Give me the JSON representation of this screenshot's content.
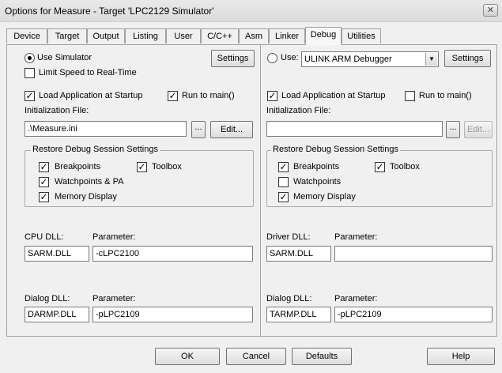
{
  "window": {
    "title": "Options for Measure - Target 'LPC2129 Simulator'",
    "close_glyph": "✕"
  },
  "tabs": [
    {
      "label": "Device",
      "active": false
    },
    {
      "label": "Target",
      "active": false
    },
    {
      "label": "Output",
      "active": false
    },
    {
      "label": "Listing",
      "active": false
    },
    {
      "label": "User",
      "active": false
    },
    {
      "label": "C/C++",
      "active": false
    },
    {
      "label": "Asm",
      "active": false
    },
    {
      "label": "Linker",
      "active": false
    },
    {
      "label": "Debug",
      "active": true
    },
    {
      "label": "Utilities",
      "active": false
    }
  ],
  "left": {
    "use_simulator": {
      "label": "Use Simulator",
      "selected": true
    },
    "settings_label": "Settings",
    "limit_speed": {
      "label": "Limit Speed to Real-Time",
      "checked": false
    },
    "load_app": {
      "label": "Load Application at Startup",
      "checked": true
    },
    "run_to_main": {
      "label": "Run to main()",
      "checked": true
    },
    "init_file_label": "Initialization File:",
    "init_file_value": ".\\Measure.ini",
    "browse_label": "...",
    "edit_label": "Edit...",
    "restore_group": {
      "title": "Restore Debug Session Settings",
      "breakpoints": {
        "label": "Breakpoints",
        "checked": true
      },
      "toolbox": {
        "label": "Toolbox",
        "checked": true
      },
      "watchpoints": {
        "label": "Watchpoints & PA",
        "checked": true
      },
      "memory_display": {
        "label": "Memory Display",
        "checked": true
      }
    },
    "cpu_dll_label": "CPU DLL:",
    "cpu_dll_value": "SARM.DLL",
    "cpu_param_label": "Parameter:",
    "cpu_param_value": "-cLPC2100",
    "dialog_dll_label": "Dialog DLL:",
    "dialog_dll_value": "DARMP.DLL",
    "dialog_param_label": "Parameter:",
    "dialog_param_value": "-pLPC2109"
  },
  "right": {
    "use_label": "Use:",
    "use_selected": false,
    "debugger_value": "ULINK ARM Debugger",
    "settings_label": "Settings",
    "load_app": {
      "label": "Load Application at Startup",
      "checked": true
    },
    "run_to_main": {
      "label": "Run to main()",
      "checked": false
    },
    "init_file_label": "Initialization File:",
    "init_file_value": "",
    "browse_label": "...",
    "edit_label": "Edit...",
    "restore_group": {
      "title": "Restore Debug Session Settings",
      "breakpoints": {
        "label": "Breakpoints",
        "checked": true
      },
      "toolbox": {
        "label": "Toolbox",
        "checked": true
      },
      "watchpoints": {
        "label": "Watchpoints",
        "checked": false
      },
      "memory_display": {
        "label": "Memory Display",
        "checked": true
      }
    },
    "driver_dll_label": "Driver DLL:",
    "driver_dll_value": "SARM.DLL",
    "driver_param_label": "Parameter:",
    "driver_param_value": "",
    "dialog_dll_label": "Dialog DLL:",
    "dialog_dll_value": "TARMP.DLL",
    "dialog_param_label": "Parameter:",
    "dialog_param_value": "-pLPC2109"
  },
  "buttons": {
    "ok": "OK",
    "cancel": "Cancel",
    "defaults": "Defaults",
    "help": "Help"
  },
  "glyphs": {
    "check": "✓",
    "dropdown": "▼"
  }
}
